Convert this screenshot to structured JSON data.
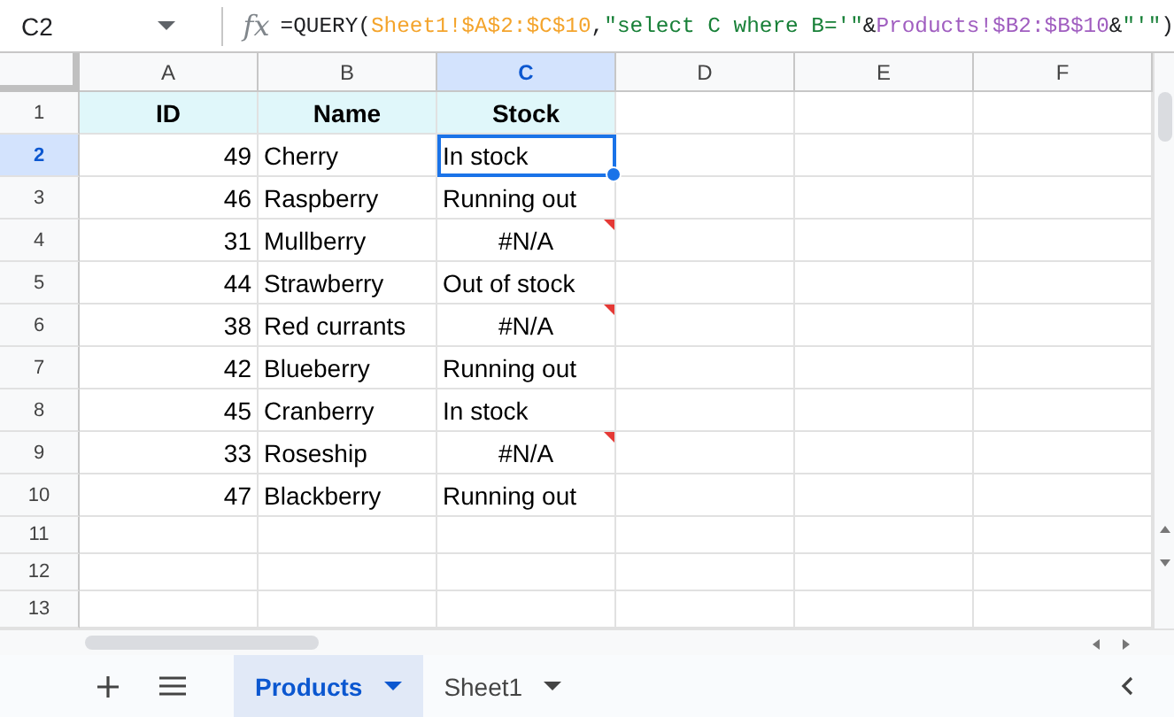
{
  "name_box": "C2",
  "function_label": "fx",
  "formula": [
    {
      "text": "=QUERY(",
      "color": "#202124"
    },
    {
      "text": "Sheet1!$A$2:$C$10",
      "color": "#f4a42c"
    },
    {
      "text": ",",
      "color": "#202124"
    },
    {
      "text": "\"select C where B='\"",
      "color": "#188038"
    },
    {
      "text": "&",
      "color": "#202124"
    },
    {
      "text": "Products!$B2:$B$10",
      "color": "#a05ec0"
    },
    {
      "text": "&",
      "color": "#202124"
    },
    {
      "text": "\"'\"",
      "color": "#188038"
    },
    {
      "text": ")",
      "color": "#202124"
    }
  ],
  "columns": [
    {
      "label": "A",
      "selected": false
    },
    {
      "label": "B",
      "selected": false
    },
    {
      "label": "C",
      "selected": true
    },
    {
      "label": "D",
      "selected": false
    },
    {
      "label": "E",
      "selected": false
    },
    {
      "label": "F",
      "selected": false
    }
  ],
  "rows": [
    {
      "number": "1",
      "selected": false,
      "kind": "header",
      "cells": [
        {
          "text": "ID"
        },
        {
          "text": "Name"
        },
        {
          "text": "Stock"
        }
      ]
    },
    {
      "number": "2",
      "selected": true,
      "kind": "data",
      "cells": [
        {
          "text": "49"
        },
        {
          "text": "Cherry"
        },
        {
          "text": "In stock",
          "error": false
        }
      ]
    },
    {
      "number": "3",
      "selected": false,
      "kind": "data",
      "cells": [
        {
          "text": "46"
        },
        {
          "text": "Raspberry"
        },
        {
          "text": "Running out",
          "error": false
        }
      ]
    },
    {
      "number": "4",
      "selected": false,
      "kind": "data",
      "cells": [
        {
          "text": "31"
        },
        {
          "text": "Mullberry"
        },
        {
          "text": "#N/A",
          "error": true
        }
      ]
    },
    {
      "number": "5",
      "selected": false,
      "kind": "data",
      "cells": [
        {
          "text": "44"
        },
        {
          "text": "Strawberry"
        },
        {
          "text": "Out of stock",
          "error": false
        }
      ]
    },
    {
      "number": "6",
      "selected": false,
      "kind": "data",
      "cells": [
        {
          "text": "38"
        },
        {
          "text": "Red currants"
        },
        {
          "text": "#N/A",
          "error": true
        }
      ]
    },
    {
      "number": "7",
      "selected": false,
      "kind": "data",
      "cells": [
        {
          "text": "42"
        },
        {
          "text": "Blueberry"
        },
        {
          "text": "Running out",
          "error": false
        }
      ]
    },
    {
      "number": "8",
      "selected": false,
      "kind": "data",
      "cells": [
        {
          "text": "45"
        },
        {
          "text": "Cranberry"
        },
        {
          "text": "In stock",
          "error": false
        }
      ]
    },
    {
      "number": "9",
      "selected": false,
      "kind": "data",
      "cells": [
        {
          "text": "33"
        },
        {
          "text": "Roseship"
        },
        {
          "text": "#N/A",
          "error": true
        }
      ]
    },
    {
      "number": "10",
      "selected": false,
      "kind": "data",
      "cells": [
        {
          "text": "47"
        },
        {
          "text": "Blackberry"
        },
        {
          "text": "Running out",
          "error": false
        }
      ]
    },
    {
      "number": "11",
      "selected": false,
      "kind": "empty"
    },
    {
      "number": "12",
      "selected": false,
      "kind": "empty"
    },
    {
      "number": "13",
      "selected": false,
      "kind": "empty"
    }
  ],
  "sheet_tabs": [
    {
      "label": "Products",
      "selected": true
    },
    {
      "label": "Sheet1",
      "selected": false
    }
  ]
}
